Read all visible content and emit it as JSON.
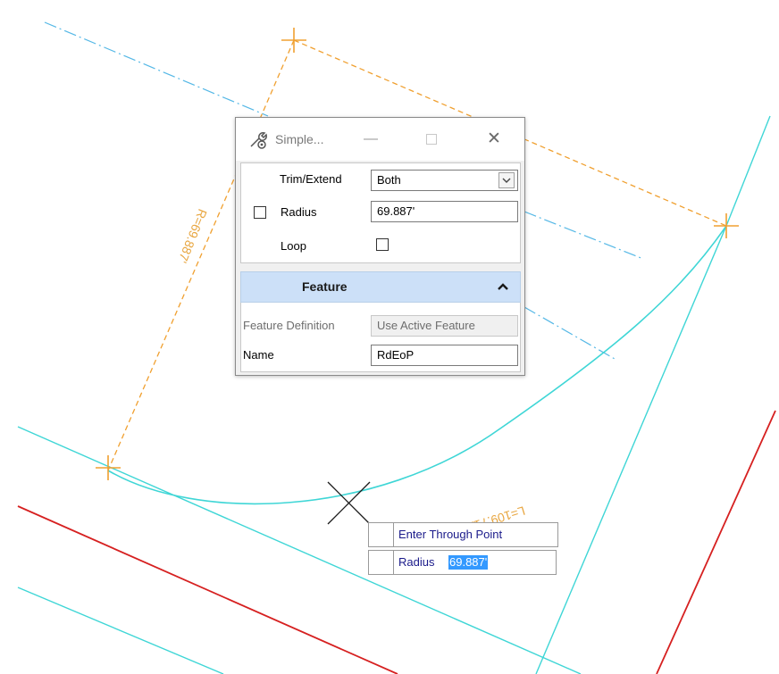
{
  "dialog": {
    "title": "Simple...",
    "icon": "settings-wrench-icon",
    "minimize_glyph": "—",
    "close_glyph": "✕",
    "trim_extend_label": "Trim/Extend",
    "trim_extend_value": "Both",
    "radius_label": "Radius",
    "radius_checked": false,
    "radius_value": "69.887'",
    "loop_label": "Loop",
    "loop_checked": false,
    "feature_section_title": "Feature",
    "feature_definition_label": "Feature Definition",
    "feature_definition_value": "Use Active Feature",
    "name_label": "Name",
    "name_value": "RdEoP"
  },
  "drawing": {
    "radius_annotation": "R=69.887'",
    "length_annotation": "L=109.711'",
    "colors": {
      "cyan": "#3fd6d6",
      "red": "#d62020",
      "orange": "#f0a030",
      "dash_blue": "#55b8e6"
    }
  },
  "prompt": {
    "instruction": "Enter Through Point",
    "radius_label": "Radius",
    "radius_value": "69.887'"
  }
}
